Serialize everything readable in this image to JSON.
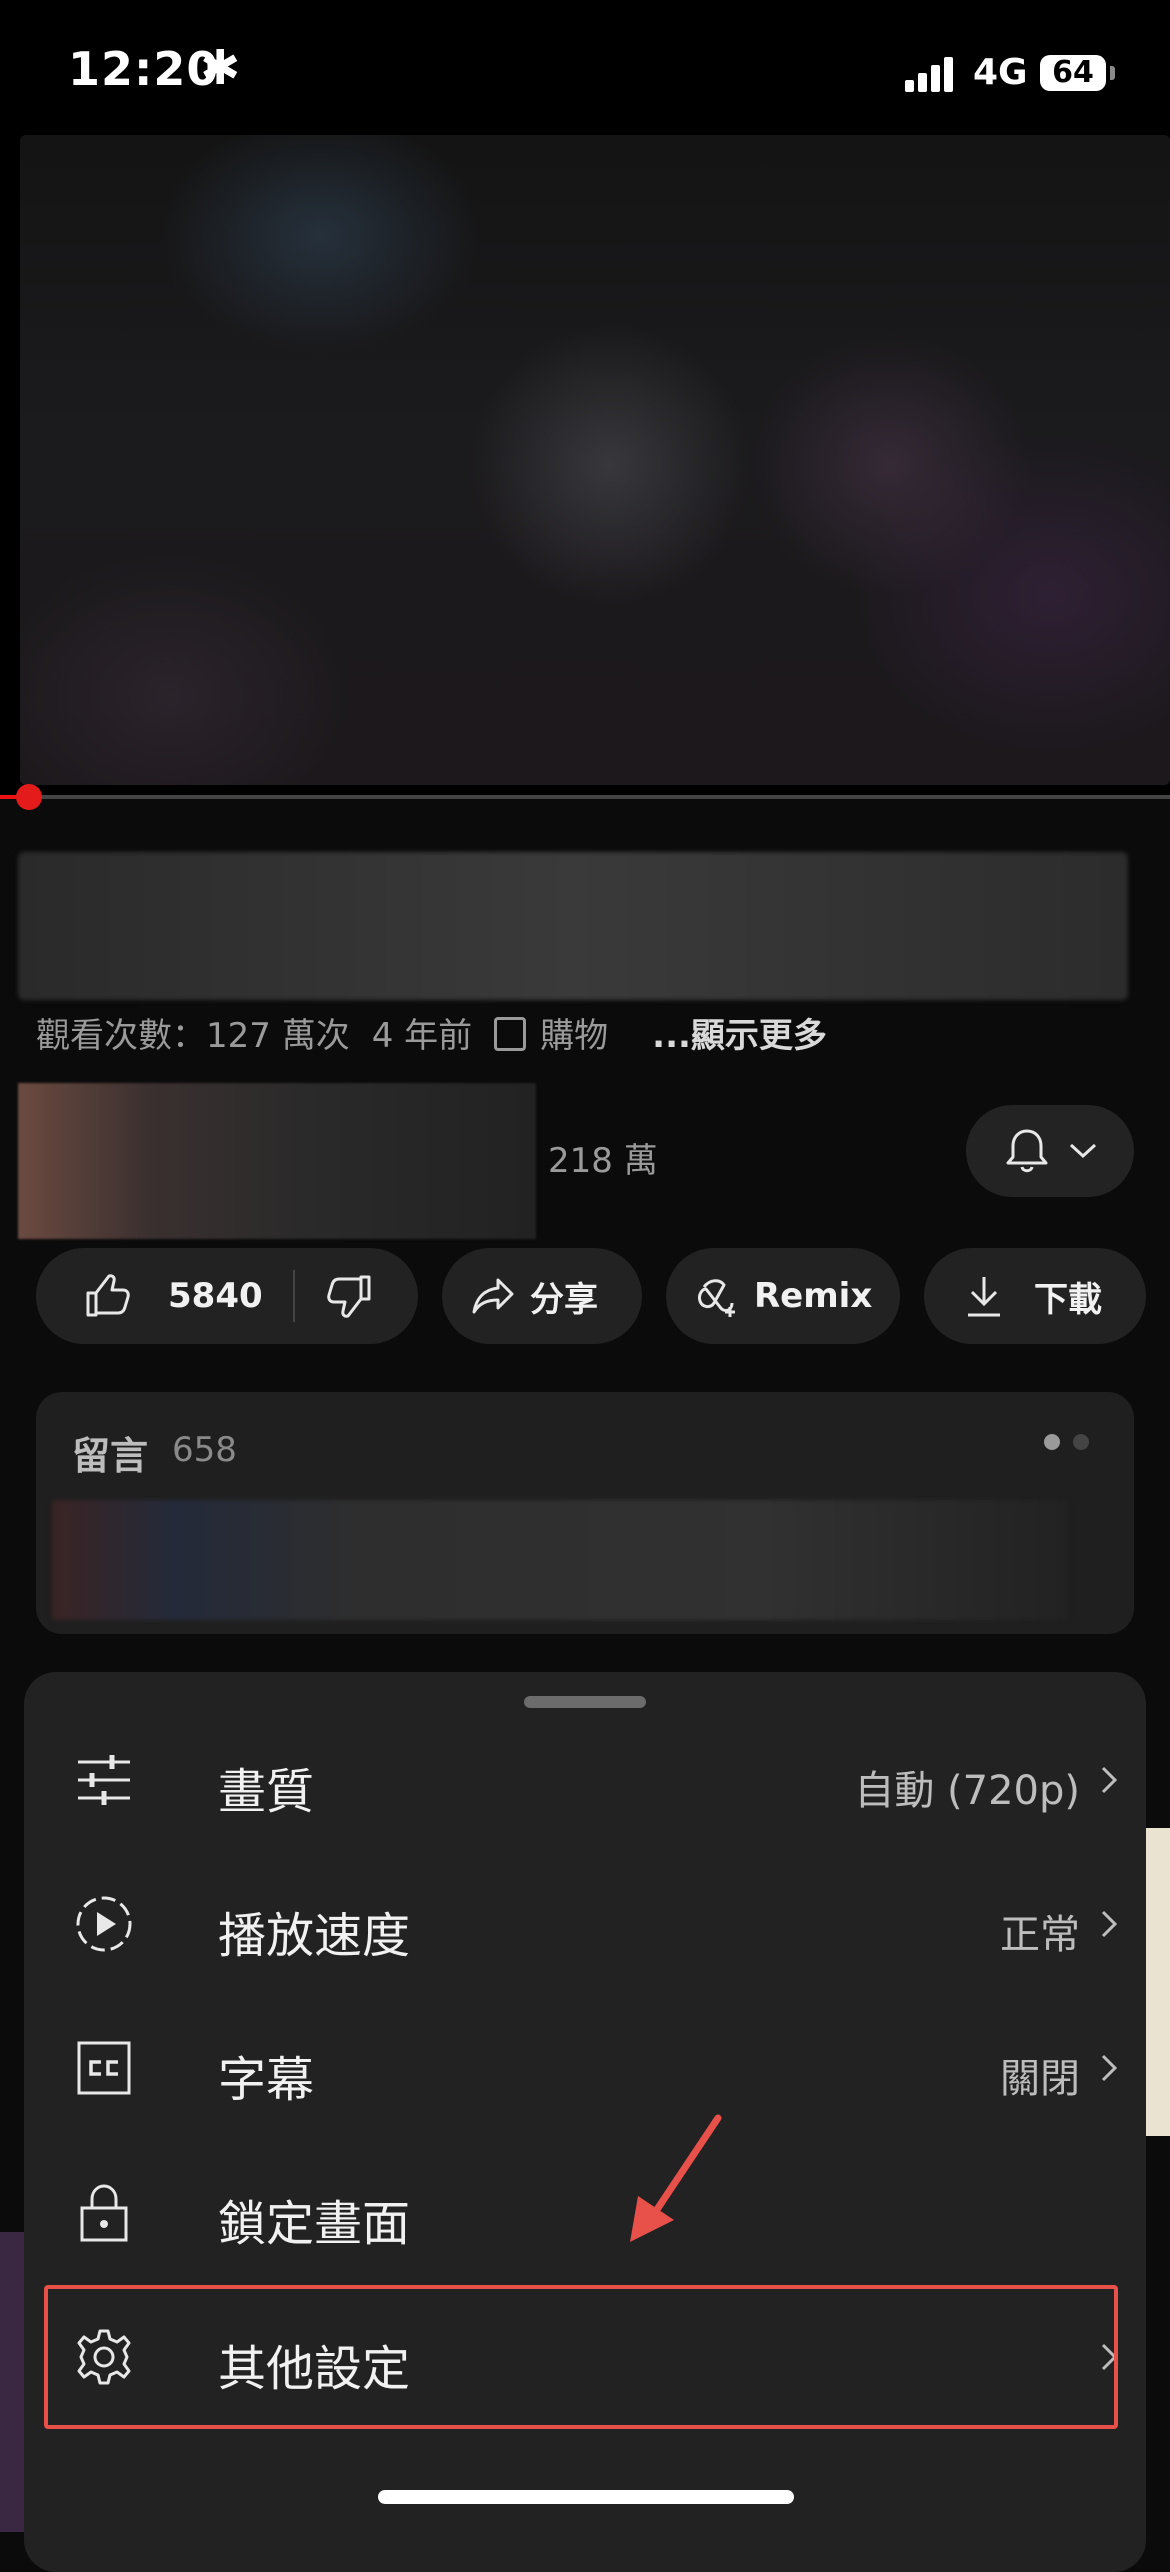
{
  "status_bar": {
    "time": "12:20",
    "time_icon": "✱",
    "network": "4G",
    "battery": "64"
  },
  "video": {
    "progress": 0.03
  },
  "meta": {
    "views": "觀看次數：127 萬次",
    "age": "4 年前",
    "shopping": "購物",
    "more": "...顯示更多"
  },
  "channel": {
    "subscribers": "218 萬"
  },
  "actions": {
    "likes": "5840",
    "share": "分享",
    "remix": "Remix",
    "download": "下載"
  },
  "comments": {
    "title": "留言",
    "count": "658"
  },
  "sheet": {
    "items": [
      {
        "label": "畫質",
        "value": "自動 (720p)",
        "icon": "sliders-icon",
        "chevron": true
      },
      {
        "label": "播放速度",
        "value": "正常",
        "icon": "playback-speed-icon",
        "chevron": true
      },
      {
        "label": "字幕",
        "value": "關閉",
        "icon": "captions-icon",
        "chevron": true
      },
      {
        "label": "鎖定畫面",
        "value": "",
        "icon": "lock-icon",
        "chevron": false
      },
      {
        "label": "其他設定",
        "value": "",
        "icon": "gear-icon",
        "chevron": true
      }
    ]
  },
  "annotation": {
    "highlight_color": "#e8504a"
  }
}
